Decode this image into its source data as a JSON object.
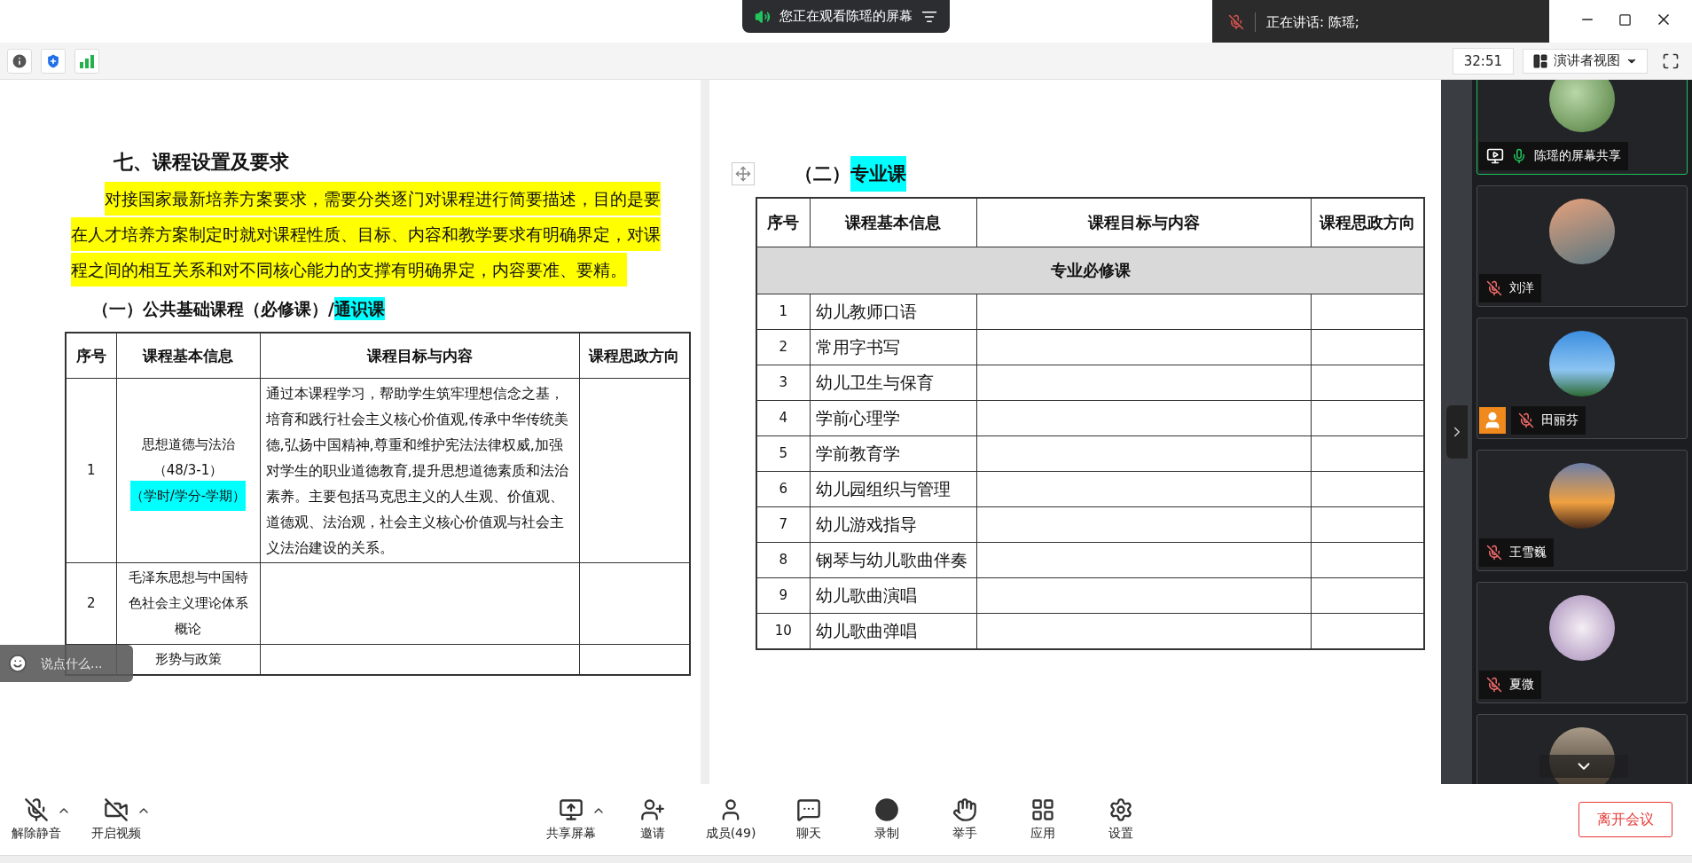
{
  "top_bar": {
    "banner": "您正在观看陈瑶的屏幕",
    "speaking": "正在讲话: 陈瑶;"
  },
  "info_bar": {
    "timer": "32:51",
    "view_mode": "演讲者视图"
  },
  "left_page": {
    "heading": "七、课程设置及要求",
    "intro": "对接国家最新培养方案要求，需要分类逐门对课程进行简要描述，目的是要在人才培养方案制定时就对课程性质、目标、内容和教学要求有明确界定，对课程之间的相互关系和对不同核心能力的支撑有明确界定，内容要准、要精。",
    "section_title": "（一）公共基础课程（必修课）/",
    "section_highlight": "通识课",
    "columns": [
      "序号",
      "课程基本信息",
      "课程目标与内容",
      "课程思政方向"
    ],
    "rows": [
      {
        "index": "1",
        "course_lines": [
          {
            "text": "思想道德与法治",
            "highlighted": false
          },
          {
            "text": "（48/3-1）",
            "highlighted": false
          },
          {
            "text": "（学时/学分-学期）",
            "highlighted": true
          }
        ],
        "goals": "通过本课程学习，帮助学生筑牢理想信念之基，培育和践行社会主义核心价值观,传承中华传统美德,弘扬中国精神,尊重和维护宪法法律权威,加强对学生的职业道德教育,提升思想道德素质和法治素养。主要包括马克思主义的人生观、价值观、道德观、法治观，社会主义核心价值观与社会主义法治建设的关系。"
      },
      {
        "index": "2",
        "course_lines": [
          {
            "text": "毛泽东思想与中国特色社会主义理论体系概论",
            "highlighted": false
          }
        ]
      },
      {
        "course_lines": [
          {
            "text": "形势与政策",
            "highlighted": false
          }
        ]
      }
    ]
  },
  "right_page": {
    "title": "（二）",
    "title_highlight": "专业课",
    "columns": [
      "序号",
      "课程基本信息",
      "课程目标与内容",
      "课程思政方向"
    ],
    "rows": [
      {
        "kind": "group",
        "label": "专业必修课"
      },
      {
        "kind": "course",
        "index": "1",
        "course": "幼儿教师口语"
      },
      {
        "kind": "course",
        "index": "2",
        "course": "常用字书写"
      },
      {
        "kind": "course",
        "index": "3",
        "course": "幼儿卫生与保育"
      },
      {
        "kind": "course",
        "index": "4",
        "course": "学前心理学"
      },
      {
        "kind": "course",
        "index": "5",
        "course": "学前教育学"
      },
      {
        "kind": "course",
        "index": "6",
        "course": "幼儿园组织与管理"
      },
      {
        "kind": "course",
        "index": "7",
        "course": "幼儿游戏指导"
      },
      {
        "kind": "course",
        "index": "8",
        "course": "钢琴与幼儿歌曲伴奏"
      },
      {
        "kind": "course",
        "index": "9",
        "course": "幼儿歌曲演唱"
      },
      {
        "kind": "course",
        "index": "10",
        "course": "幼儿歌曲弹唱"
      }
    ]
  },
  "chat_input": {
    "placeholder": "说点什么..."
  },
  "participants": [
    {
      "kind": "screen_share",
      "name": "陈瑶的屏幕共享",
      "muted": false,
      "speaking": true,
      "badge": false
    },
    {
      "kind": "member",
      "name": "刘洋",
      "muted": true,
      "speaking": false,
      "badge": false
    },
    {
      "kind": "member",
      "name": "田丽芬",
      "muted": true,
      "speaking": false,
      "badge": true
    },
    {
      "kind": "member",
      "name": "王雪巍",
      "muted": true,
      "speaking": false,
      "badge": false
    },
    {
      "kind": "member",
      "name": "夏微",
      "muted": true,
      "speaking": false,
      "badge": false
    },
    {
      "kind": "partial"
    }
  ],
  "toolbar": {
    "left": [
      {
        "kind": "mic_off",
        "label": "解除静音",
        "has_menu": true
      },
      {
        "kind": "video_off",
        "label": "开启视频",
        "has_menu": true
      }
    ],
    "center": [
      {
        "kind": "share",
        "label": "共享屏幕",
        "has_menu": true
      },
      {
        "kind": "invite",
        "label": "邀请",
        "has_menu": false
      },
      {
        "kind": "members",
        "label": "成员(49)",
        "has_menu": false
      },
      {
        "kind": "chat",
        "label": "聊天",
        "has_menu": false
      },
      {
        "kind": "record",
        "label": "录制",
        "has_menu": false
      },
      {
        "kind": "hand",
        "label": "举手",
        "has_menu": false
      },
      {
        "kind": "apps",
        "label": "应用",
        "has_menu": false
      },
      {
        "kind": "settings",
        "label": "设置",
        "has_menu": false
      }
    ],
    "leave": "离开会议"
  }
}
